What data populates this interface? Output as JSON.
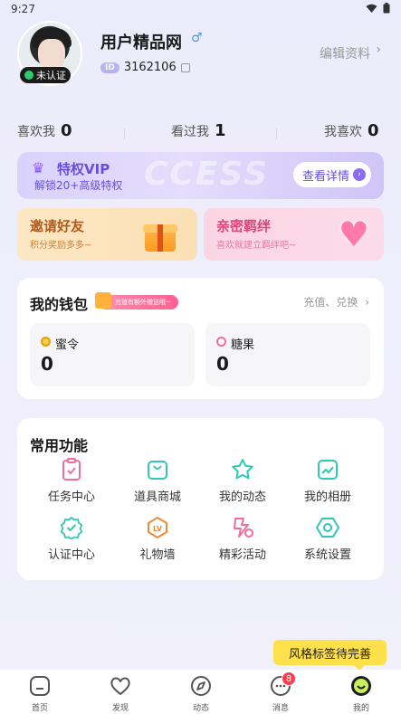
{
  "status_bar": {
    "time": "9:27"
  },
  "profile": {
    "username": "用户精品网",
    "gender_symbol": "♂",
    "id_label": "ID",
    "id_value": "3162106",
    "verify_label": "未认证",
    "edit_label": "编辑资料",
    "edit_chevron": "›"
  },
  "stats": [
    {
      "label": "喜欢我",
      "value": "0"
    },
    {
      "label": "看过我",
      "value": "1"
    },
    {
      "label": "我喜欢",
      "value": "0"
    }
  ],
  "vip": {
    "title": "特权VIP",
    "subtitle": "解锁20+高级特权",
    "watermark": "CCESS",
    "button": "查看详情"
  },
  "promos": {
    "invite": {
      "title": "邀请好友",
      "subtitle": "积分奖励多多~"
    },
    "bond": {
      "title": "亲密羁绊",
      "subtitle": "喜欢就建立羁绊吧~"
    }
  },
  "wallet": {
    "title": "我的钱包",
    "tag": "充值有额外赠送哦~",
    "recharge_link": "充值、兑换",
    "recharge_chevron": "›",
    "items": [
      {
        "label": "蜜令",
        "value": "0"
      },
      {
        "label": "糖果",
        "value": "0"
      }
    ]
  },
  "functions": {
    "title": "常用功能",
    "items": [
      {
        "label": "任务中心",
        "icon": "task-icon"
      },
      {
        "label": "道具商城",
        "icon": "shopping-bag-icon"
      },
      {
        "label": "我的动态",
        "icon": "star-icon"
      },
      {
        "label": "我的相册",
        "icon": "photo-icon"
      },
      {
        "label": "认证中心",
        "icon": "verified-badge-icon"
      },
      {
        "label": "礼物墙",
        "icon": "lv-icon"
      },
      {
        "label": "精彩活动",
        "icon": "activity-icon"
      },
      {
        "label": "系统设置",
        "icon": "settings-icon"
      }
    ]
  },
  "toast": {
    "text": "风格标签待完善"
  },
  "tabbar": {
    "items": [
      {
        "label": "首页",
        "icon": "home-icon"
      },
      {
        "label": "发现",
        "icon": "heart-icon"
      },
      {
        "label": "动态",
        "icon": "compass-icon"
      },
      {
        "label": "消息",
        "icon": "message-icon",
        "badge": "8"
      },
      {
        "label": "我的",
        "icon": "profile-icon"
      }
    ]
  },
  "colors": {
    "accent_purple": "#6a4de0",
    "teal_icons": "#2fc7b5",
    "pink_icons": "#f06f9a",
    "orange_icons": "#f08a3a",
    "badge_red": "#ff3b50",
    "toast_yellow": "#fde04a"
  }
}
